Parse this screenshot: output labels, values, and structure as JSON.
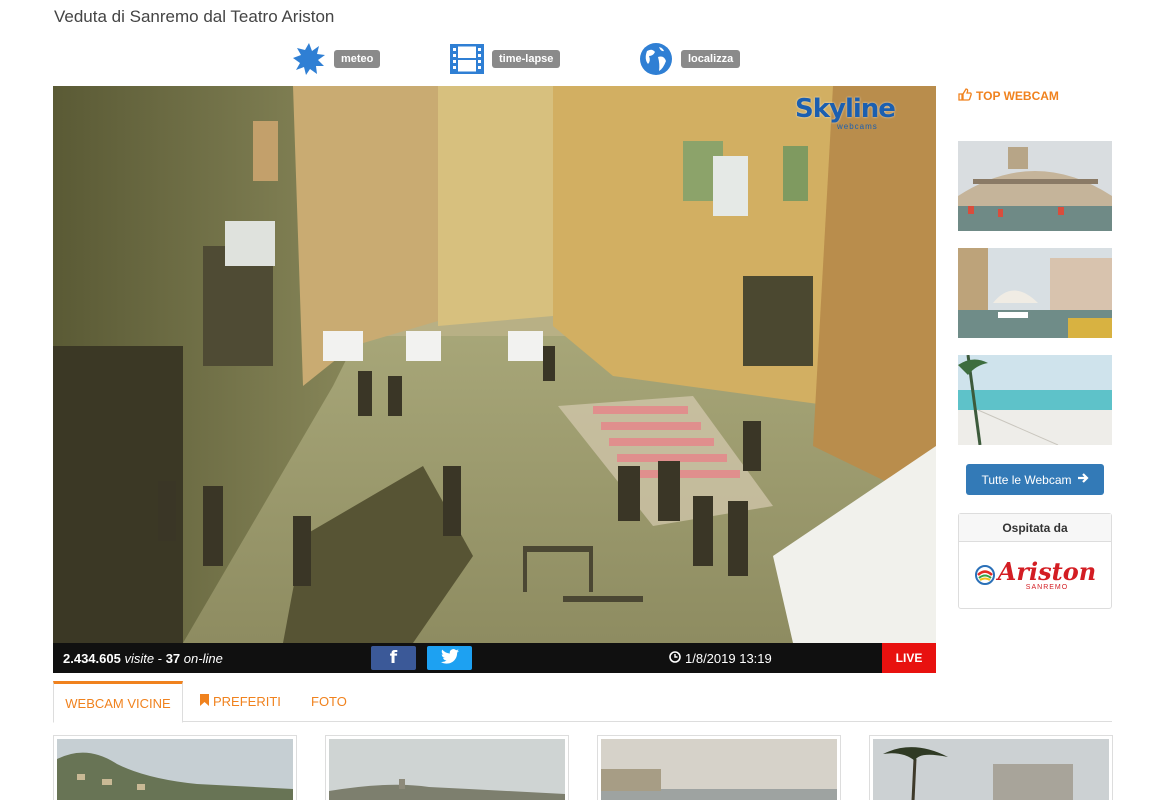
{
  "page": {
    "title": "Veduta di Sanremo dal Teatro Ariston"
  },
  "tools": [
    {
      "label": "meteo",
      "icon": "sun-icon"
    },
    {
      "label": "time-lapse",
      "icon": "film-icon"
    },
    {
      "label": "localizza",
      "icon": "globe-icon"
    }
  ],
  "player": {
    "logo": "Skyline",
    "logo_sub": "webcams",
    "visits": "2.434.605",
    "visits_label": "visite",
    "separator": "-",
    "online": "37",
    "online_label": "on-line",
    "facebook": "f",
    "datetime": "1/8/2019 13:19",
    "live": "LIVE"
  },
  "sidebar": {
    "top_title": "TOP WEBCAM",
    "all_button": "Tutte le Webcam",
    "host_title": "Ospitata da",
    "host_logo": "Ariston",
    "host_logo_sub": "SANREMO"
  },
  "tabs": [
    {
      "label": "WEBCAM VICINE",
      "active": true
    },
    {
      "label": "PREFERITI",
      "active": false
    },
    {
      "label": "FOTO",
      "active": false
    }
  ],
  "colors": {
    "accent": "#f0821e",
    "button_blue": "#337ab7",
    "live_red": "#e8110f",
    "facebook": "#3b5998",
    "twitter": "#1da1f2"
  }
}
